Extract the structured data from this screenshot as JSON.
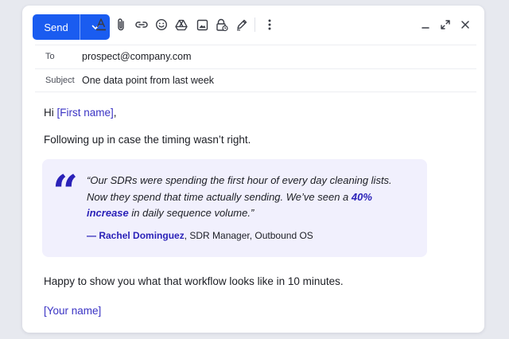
{
  "toolbar": {
    "send_label": "Send",
    "icons": [
      "chevron-down-icon",
      "text-color-icon",
      "attachment-icon",
      "link-icon",
      "emoji-icon",
      "drive-icon",
      "image-icon",
      "lock-clock-icon",
      "signature-pen-icon",
      "more-vertical-icon"
    ],
    "window_icons": [
      "minimize-icon",
      "expand-icon",
      "close-icon"
    ]
  },
  "header": {
    "to_label": "To",
    "to_value": "prospect@company.com",
    "subject_label": "Subject",
    "subject_value": "One data point from last week"
  },
  "message": {
    "greeting_prefix": "Hi ",
    "greeting_name": "[First name]",
    "greeting_suffix": ",",
    "line1": "Following up in case the timing wasn’t right.",
    "quote_mark": "“",
    "quote_part1": "“Our SDRs were spending the first hour of every day cleaning lists. Now they spend that time actually sending. We’ve seen a ",
    "quote_highlight": "40% increase",
    "quote_part2": " in daily sequence volume.”",
    "attribution_dash": "— ",
    "attribution_name": "Rachel Dominguez",
    "attribution_role": ", SDR Manager, Outbound OS",
    "closing": "Happy to show you what that workflow looks like in 10 minutes.",
    "signature": "[Your name]"
  },
  "colors": {
    "accent": "#1a5cf0",
    "brand_purple": "#2b22b8",
    "quote_bg": "#f1f0fd"
  }
}
